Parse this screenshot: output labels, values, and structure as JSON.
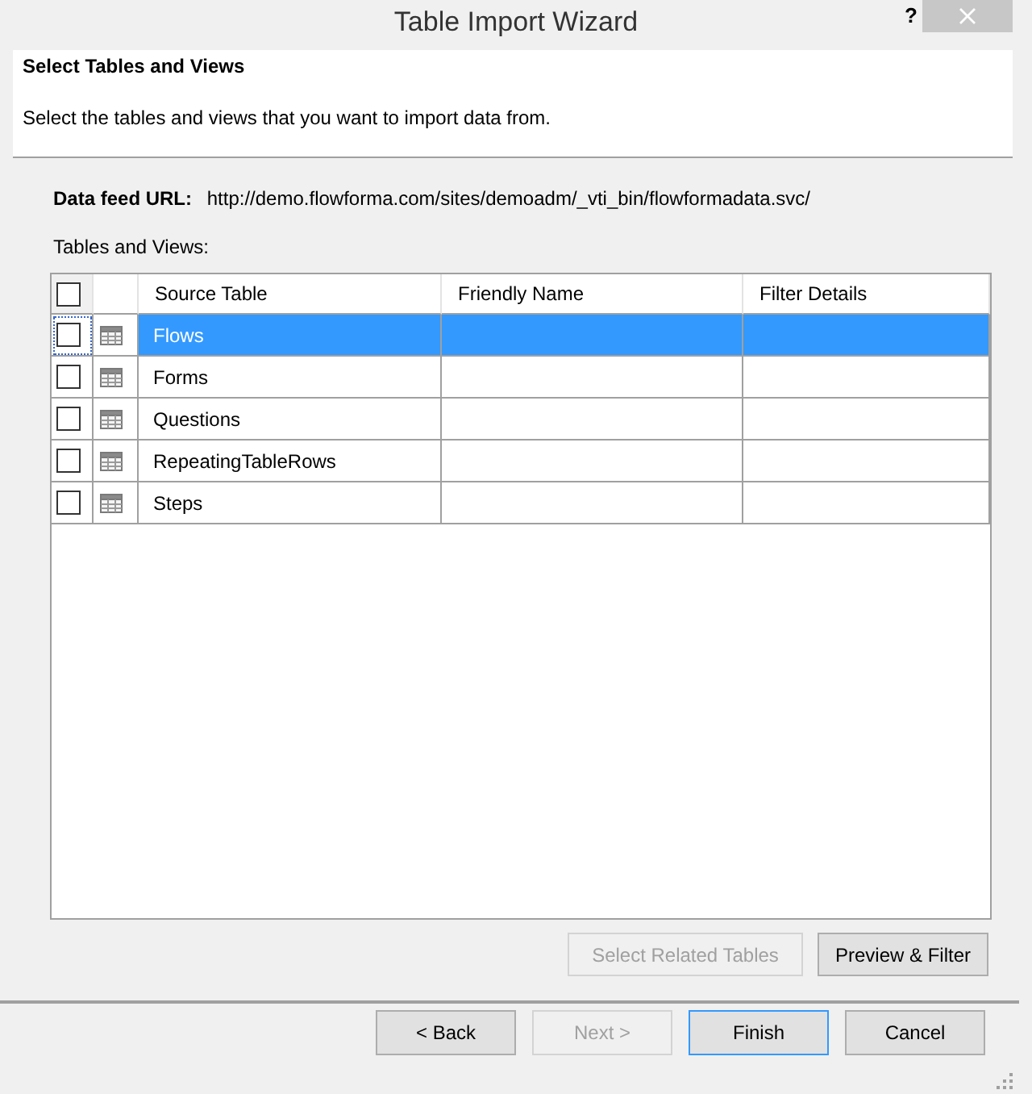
{
  "window": {
    "title": "Table Import Wizard",
    "help_label": "?"
  },
  "header": {
    "title": "Select Tables and Views",
    "description": "Select the tables and views that you want to import data from."
  },
  "data_feed": {
    "label": "Data feed URL:",
    "url": "http://demo.flowforma.com/sites/demoadm/_vti_bin/flowformadata.svc/"
  },
  "tables": {
    "label": "Tables and Views:",
    "select_all_checked": false,
    "columns": [
      "Source Table",
      "Friendly Name",
      "Filter Details"
    ],
    "rows": [
      {
        "source_table": "Flows",
        "checked": false,
        "selected": true
      },
      {
        "source_table": "Forms",
        "checked": false,
        "selected": false
      },
      {
        "source_table": "Questions",
        "checked": false,
        "selected": false
      },
      {
        "source_table": "RepeatingTableRows",
        "checked": false,
        "selected": false
      },
      {
        "source_table": "Steps",
        "checked": false,
        "selected": false
      }
    ]
  },
  "actions": [
    {
      "label": "Select Related Tables",
      "disabled": true
    },
    {
      "label": "Preview & Filter",
      "disabled": false
    }
  ],
  "navigation": [
    {
      "label": "< Back",
      "disabled": false,
      "focused": false
    },
    {
      "label": "Next >",
      "disabled": true,
      "focused": false
    },
    {
      "label": "Finish",
      "disabled": false,
      "focused": true
    },
    {
      "label": "Cancel",
      "disabled": false,
      "focused": false
    }
  ]
}
